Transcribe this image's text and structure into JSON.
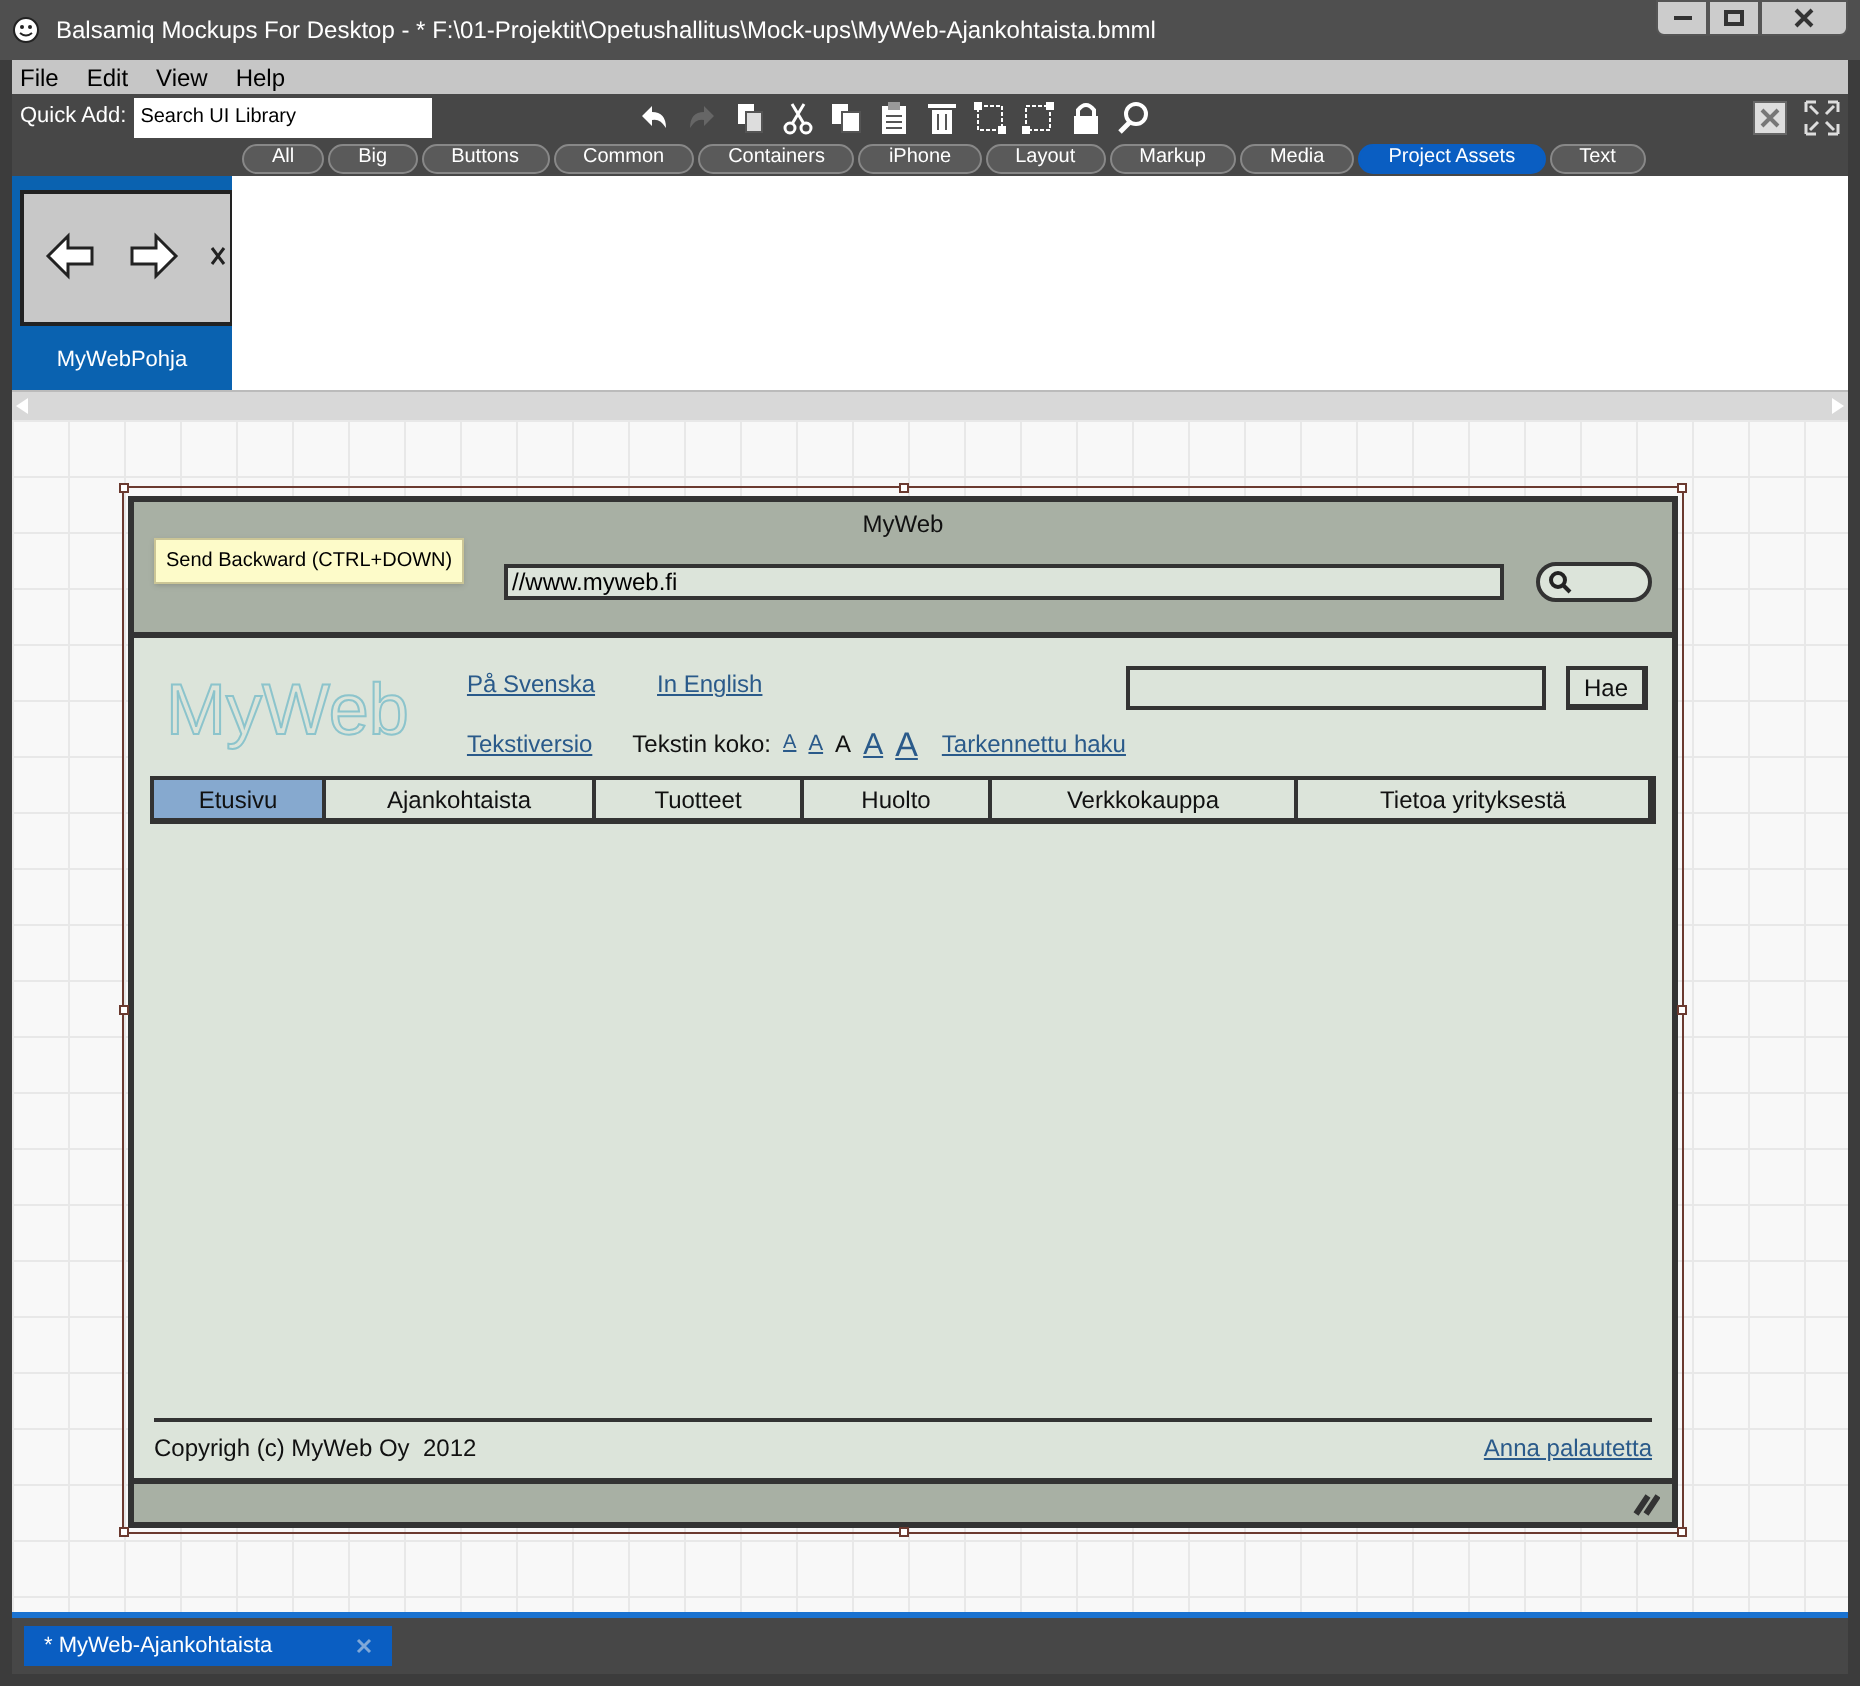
{
  "window": {
    "title": "Balsamiq Mockups For Desktop - * F:\\01-Projektit\\Opetushallitus\\Mock-ups\\MyWeb-Ajankohtaista.bmml"
  },
  "menu": [
    "File",
    "Edit",
    "View",
    "Help"
  ],
  "quick_add": {
    "label": "Quick Add:",
    "placeholder": "Search UI Library"
  },
  "categories": [
    {
      "label": "All",
      "selected": false
    },
    {
      "label": "Big",
      "selected": false
    },
    {
      "label": "Buttons",
      "selected": false
    },
    {
      "label": "Common",
      "selected": false
    },
    {
      "label": "Containers",
      "selected": false
    },
    {
      "label": "iPhone",
      "selected": false
    },
    {
      "label": "Layout",
      "selected": false
    },
    {
      "label": "Markup",
      "selected": false
    },
    {
      "label": "Media",
      "selected": false
    },
    {
      "label": "Project Assets",
      "selected": true
    },
    {
      "label": "Text",
      "selected": false
    }
  ],
  "assets": [
    {
      "name": "MyWebPohja",
      "selected": true
    }
  ],
  "mockup": {
    "title": "MyWeb",
    "url": "//www.myweb.fi",
    "tooltip": "Send Backward (CTRL+DOWN)",
    "logo": "MyWeb",
    "links_top": [
      "På Svenska",
      "In English"
    ],
    "text_version": "Tekstiversio",
    "text_size_label": "Tekstin koko:",
    "text_sizes": [
      {
        "label": "A",
        "link": true
      },
      {
        "label": "A",
        "link": true
      },
      {
        "label": "A",
        "link": false
      },
      {
        "label": "A",
        "link": true
      },
      {
        "label": "A",
        "link": true
      }
    ],
    "advanced_search": "Tarkennettu haku",
    "search_button": "Hae",
    "nav": [
      {
        "label": "Etusivu",
        "selected": true
      },
      {
        "label": "Ajankohtaista",
        "selected": false
      },
      {
        "label": "Tuotteet",
        "selected": false
      },
      {
        "label": "Huolto",
        "selected": false
      },
      {
        "label": "Verkkokauppa",
        "selected": false
      },
      {
        "label": "Tietoa yrityksestä",
        "selected": false
      }
    ],
    "footer_text": "Copyrigh (c) MyWeb Oy  2012",
    "footer_link": "Anna palautetta"
  },
  "document_tabs": [
    {
      "label": "* MyWeb-Ajankohtaista",
      "selected": true
    }
  ]
}
